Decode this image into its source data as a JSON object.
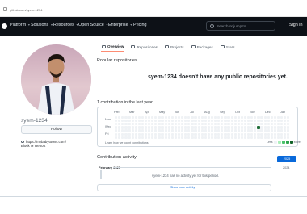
{
  "browser": {
    "url": "github.com/syem-1234"
  },
  "nav": {
    "menu": [
      {
        "label": "Platform",
        "has_dropdown": true
      },
      {
        "label": "Solutions",
        "has_dropdown": true
      },
      {
        "label": "Resources",
        "has_dropdown": true
      },
      {
        "label": "Open Source",
        "has_dropdown": true
      },
      {
        "label": "Enterprise",
        "has_dropdown": true
      },
      {
        "label": "Pricing",
        "has_dropdown": false
      }
    ],
    "search_placeholder": "Search or jump to...",
    "sign_in": "Sign in",
    "logo_icon": "github-logo-icon"
  },
  "tabs": [
    {
      "label": "Overview",
      "icon": "book-icon",
      "active": true
    },
    {
      "label": "Repositories",
      "icon": "repo-icon",
      "active": false
    },
    {
      "label": "Projects",
      "icon": "table-icon",
      "active": false
    },
    {
      "label": "Packages",
      "icon": "package-icon",
      "active": false
    },
    {
      "label": "Stars",
      "icon": "star-icon",
      "active": false
    }
  ],
  "profile": {
    "username": "syem-1234",
    "follow_label": "Follow",
    "website": "https://mybabytoons.com/",
    "block_label": "Block or Report"
  },
  "popular": {
    "title": "Popular repositories",
    "empty_message": "syem-1234 doesn't have any public repositories yet."
  },
  "contributions": {
    "title": "1 contribution in the last year",
    "months": [
      "Feb",
      "Mar",
      "Apr",
      "May",
      "Jun",
      "Jul",
      "Aug",
      "Sep",
      "Oct",
      "Nov",
      "Dec",
      "Jan"
    ],
    "days": [
      "Mon",
      "Wed",
      "Fri"
    ],
    "learn_link": "Learn how we count contributions",
    "legend_less": "Less",
    "legend_more": "More",
    "legend_colors": [
      "#eff2f5",
      "#aceebb",
      "#4ac26b",
      "#2da44e",
      "#116329"
    ],
    "active_cell": {
      "week": 43,
      "day": 3
    }
  },
  "activity": {
    "title": "Contribution activity",
    "month": "February 2025",
    "empty_message": "syem-1234 has no activity yet for this period.",
    "show_more": "Show more activity",
    "years": [
      "2025",
      "2024"
    ]
  }
}
